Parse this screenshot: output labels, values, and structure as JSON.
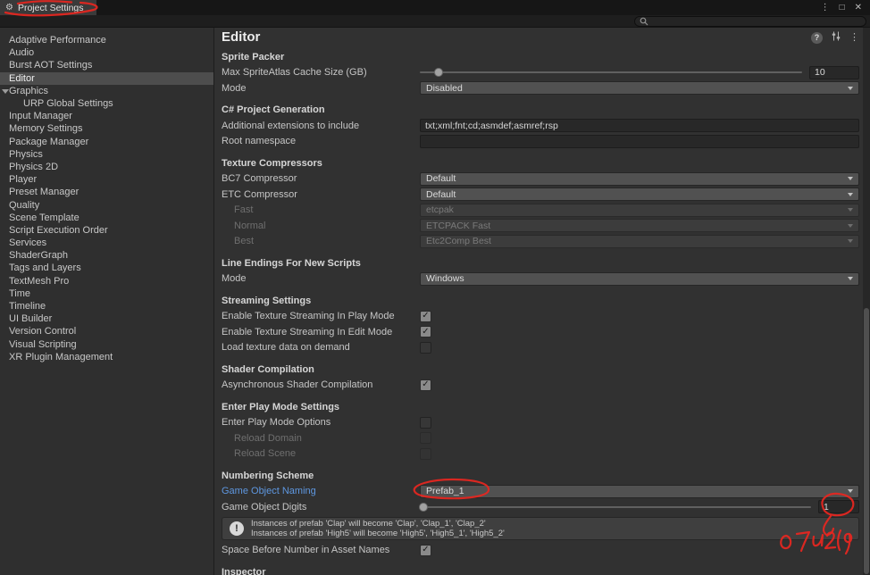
{
  "colors": {
    "annotation_red": "#e8261f",
    "selected_row": "#4d4d4d",
    "link_blue": "#5e97e0",
    "panel_bg": "#313131",
    "titlebar_bg": "#161616"
  },
  "icons": {
    "gear": "⚙",
    "window_menu": "⋮",
    "window_maximize": "□",
    "window_close": "✕",
    "help": "?",
    "panel_menu": "⋮",
    "info": "!"
  },
  "window": {
    "tab_title": "Project Settings"
  },
  "search": {
    "placeholder": ""
  },
  "sidebar": {
    "items": [
      "Adaptive Performance",
      "Audio",
      "Burst AOT Settings",
      "Editor",
      "Graphics",
      "URP Global Settings",
      "Input Manager",
      "Memory Settings",
      "Package Manager",
      "Physics",
      "Physics 2D",
      "Player",
      "Preset Manager",
      "Quality",
      "Scene Template",
      "Script Execution Order",
      "Services",
      "ShaderGraph",
      "Tags and Layers",
      "TextMesh Pro",
      "Time",
      "Timeline",
      "UI Builder",
      "Version Control",
      "Visual Scripting",
      "XR Plugin Management"
    ]
  },
  "editor": {
    "title": "Editor",
    "sprite_packer": {
      "heading": "Sprite Packer",
      "cache_label": "Max SpriteAtlas Cache Size (GB)",
      "cache_value": "10",
      "mode_label": "Mode",
      "mode_value": "Disabled"
    },
    "csharp": {
      "heading": "C# Project Generation",
      "extensions_label": "Additional extensions to include",
      "extensions_value": "txt;xml;fnt;cd;asmdef;asmref;rsp",
      "namespace_label": "Root namespace",
      "namespace_value": ""
    },
    "compressors": {
      "heading": "Texture Compressors",
      "bc7_label": "BC7 Compressor",
      "bc7_value": "Default",
      "etc_label": "ETC Compressor",
      "etc_value": "Default",
      "fast_label": "Fast",
      "fast_value": "etcpak",
      "normal_label": "Normal",
      "normal_value": "ETCPACK Fast",
      "best_label": "Best",
      "best_value": "Etc2Comp Best"
    },
    "line_endings": {
      "heading": "Line Endings For New Scripts",
      "mode_label": "Mode",
      "mode_value": "Windows"
    },
    "streaming": {
      "heading": "Streaming Settings",
      "play_label": "Enable Texture Streaming In Play Mode",
      "play_checked": true,
      "edit_label": "Enable Texture Streaming In Edit Mode",
      "edit_checked": true,
      "demand_label": "Load texture data on demand",
      "demand_checked": false
    },
    "shader": {
      "heading": "Shader Compilation",
      "async_label": "Asynchronous Shader Compilation",
      "async_checked": true
    },
    "play_mode": {
      "heading": "Enter Play Mode Settings",
      "options_label": "Enter Play Mode Options",
      "options_checked": false,
      "reload_domain_label": "Reload Domain",
      "reload_domain_checked": false,
      "reload_scene_label": "Reload Scene",
      "reload_scene_checked": false
    },
    "numbering": {
      "heading": "Numbering Scheme",
      "naming_label": "Game Object Naming",
      "naming_value": "Prefab_1",
      "digits_label": "Game Object Digits",
      "digits_value": "1",
      "info_line1": "Instances of prefab 'Clap' will become 'Clap', 'Clap_1', 'Clap_2'",
      "info_line2": "Instances of prefab 'High5' will become 'High5', 'High5_1', 'High5_2'",
      "space_label": "Space Before Number in Asset Names",
      "space_checked": true
    },
    "inspector_heading": "Inspector"
  },
  "annotations": {
    "color": "#e8261f",
    "items": [
      "tab-circled",
      "prefab-value-circled",
      "digits-value-circled",
      "handwritten-scribble"
    ]
  }
}
